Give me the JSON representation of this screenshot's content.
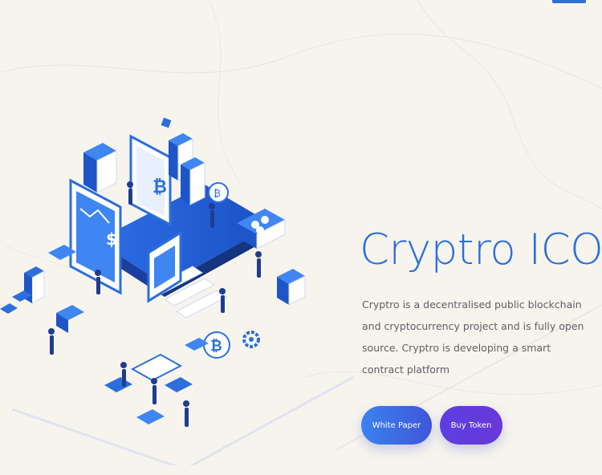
{
  "hero": {
    "title": "Cryptro ICO",
    "description": "Cryptro is a decentralised public blockchain and cryptocurrency project and is fully open source. Cryptro is developing a smart contract platform",
    "buttons": [
      {
        "label": "White Paper"
      },
      {
        "label": "Buy Token"
      }
    ]
  },
  "colors": {
    "background": "#f7f4ee",
    "accent": "#2c6fdc",
    "button_blue": "#3b82f0",
    "button_purple": "#5b3fe0"
  },
  "illustration": {
    "icons": [
      "bitcoin-icon",
      "dollar-icon",
      "gear-icon",
      "server-icon",
      "monitor-icon"
    ]
  }
}
